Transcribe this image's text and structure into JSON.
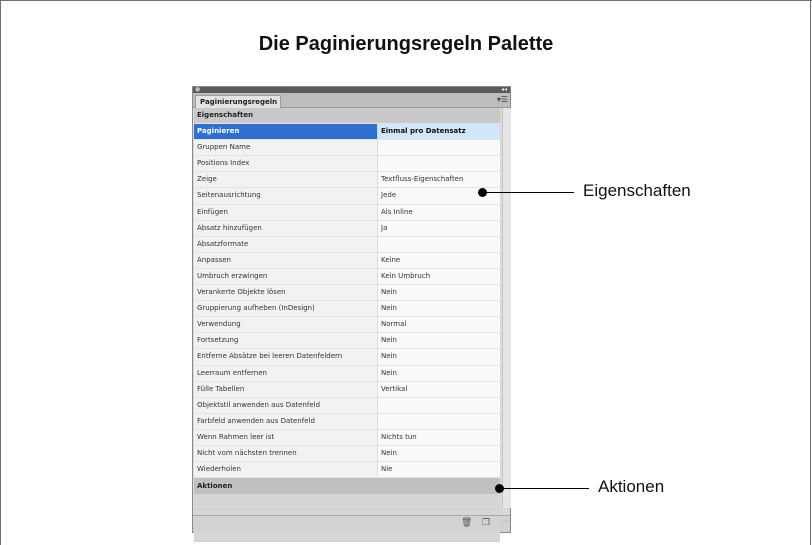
{
  "page_title": "Die Paginierungsregeln Palette",
  "panel": {
    "tab_label": "Paginierungsregeln",
    "section_properties": "Eigenschaften",
    "properties": [
      {
        "key": "Paginieren",
        "value": "Einmal pro Datensatz",
        "selected": true
      },
      {
        "key": "Gruppen Name",
        "value": ""
      },
      {
        "key": "Positions Index",
        "value": ""
      },
      {
        "key": "Zeige",
        "value": "Textfluss-Eigenschaften"
      },
      {
        "key": "Seitenausrichtung",
        "value": "Jede"
      },
      {
        "key": "Einfügen",
        "value": "Als Inline"
      },
      {
        "key": "Absatz hinzufügen",
        "value": "Ja"
      },
      {
        "key": "Absatzformate",
        "value": ""
      },
      {
        "key": "Anpassen",
        "value": "Keine"
      },
      {
        "key": "Umbruch erzwingen",
        "value": "Kein Umbruch"
      },
      {
        "key": "Verankerte Objekte lösen",
        "value": "Nein"
      },
      {
        "key": "Gruppierung aufheben (InDesign)",
        "value": "Nein"
      },
      {
        "key": "Verwendung",
        "value": "Normal"
      },
      {
        "key": "Fortsetzung",
        "value": "Nein"
      },
      {
        "key": "Entferne Absätze bei leeren Datenfeldern",
        "value": "Nein"
      },
      {
        "key": "Leerraum entfernen",
        "value": "Nein"
      },
      {
        "key": "Fülle Tabellen",
        "value": "Vertikal"
      },
      {
        "key": "Objektstil anwenden aus Datenfeld",
        "value": ""
      },
      {
        "key": "Farbfeld anwenden aus Datenfeld",
        "value": ""
      },
      {
        "key": "Wenn Rahmen leer ist",
        "value": "Nichts tun"
      },
      {
        "key": "Nicht vom nächsten trennen",
        "value": "Nein"
      },
      {
        "key": "Wiederholen",
        "value": "Nie"
      }
    ],
    "section_actions": "Aktionen",
    "footer_icons": [
      "trash-icon",
      "new-item-icon",
      "resize-grip-icon"
    ]
  },
  "callouts": {
    "properties_label": "Eigenschaften",
    "actions_label": "Aktionen"
  }
}
